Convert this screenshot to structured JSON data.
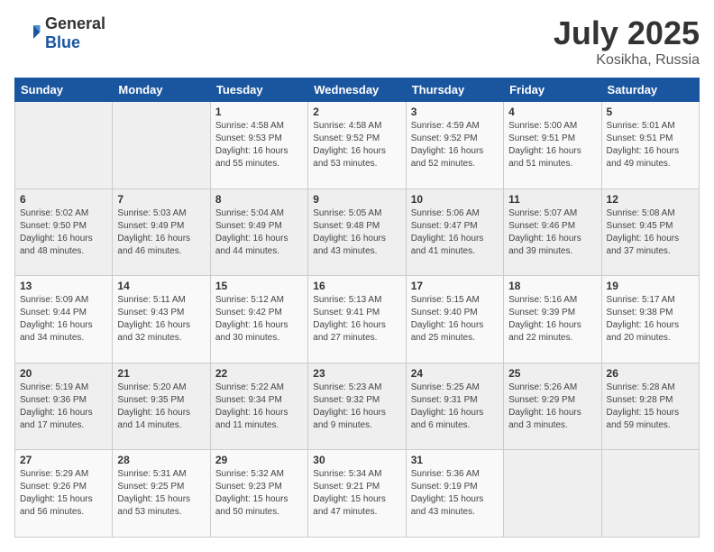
{
  "header": {
    "logo_general": "General",
    "logo_blue": "Blue",
    "month_year": "July 2025",
    "location": "Kosikha, Russia"
  },
  "weekdays": [
    "Sunday",
    "Monday",
    "Tuesday",
    "Wednesday",
    "Thursday",
    "Friday",
    "Saturday"
  ],
  "weeks": [
    [
      {
        "day": "",
        "details": ""
      },
      {
        "day": "",
        "details": ""
      },
      {
        "day": "1",
        "details": "Sunrise: 4:58 AM\nSunset: 9:53 PM\nDaylight: 16 hours\nand 55 minutes."
      },
      {
        "day": "2",
        "details": "Sunrise: 4:58 AM\nSunset: 9:52 PM\nDaylight: 16 hours\nand 53 minutes."
      },
      {
        "day": "3",
        "details": "Sunrise: 4:59 AM\nSunset: 9:52 PM\nDaylight: 16 hours\nand 52 minutes."
      },
      {
        "day": "4",
        "details": "Sunrise: 5:00 AM\nSunset: 9:51 PM\nDaylight: 16 hours\nand 51 minutes."
      },
      {
        "day": "5",
        "details": "Sunrise: 5:01 AM\nSunset: 9:51 PM\nDaylight: 16 hours\nand 49 minutes."
      }
    ],
    [
      {
        "day": "6",
        "details": "Sunrise: 5:02 AM\nSunset: 9:50 PM\nDaylight: 16 hours\nand 48 minutes."
      },
      {
        "day": "7",
        "details": "Sunrise: 5:03 AM\nSunset: 9:49 PM\nDaylight: 16 hours\nand 46 minutes."
      },
      {
        "day": "8",
        "details": "Sunrise: 5:04 AM\nSunset: 9:49 PM\nDaylight: 16 hours\nand 44 minutes."
      },
      {
        "day": "9",
        "details": "Sunrise: 5:05 AM\nSunset: 9:48 PM\nDaylight: 16 hours\nand 43 minutes."
      },
      {
        "day": "10",
        "details": "Sunrise: 5:06 AM\nSunset: 9:47 PM\nDaylight: 16 hours\nand 41 minutes."
      },
      {
        "day": "11",
        "details": "Sunrise: 5:07 AM\nSunset: 9:46 PM\nDaylight: 16 hours\nand 39 minutes."
      },
      {
        "day": "12",
        "details": "Sunrise: 5:08 AM\nSunset: 9:45 PM\nDaylight: 16 hours\nand 37 minutes."
      }
    ],
    [
      {
        "day": "13",
        "details": "Sunrise: 5:09 AM\nSunset: 9:44 PM\nDaylight: 16 hours\nand 34 minutes."
      },
      {
        "day": "14",
        "details": "Sunrise: 5:11 AM\nSunset: 9:43 PM\nDaylight: 16 hours\nand 32 minutes."
      },
      {
        "day": "15",
        "details": "Sunrise: 5:12 AM\nSunset: 9:42 PM\nDaylight: 16 hours\nand 30 minutes."
      },
      {
        "day": "16",
        "details": "Sunrise: 5:13 AM\nSunset: 9:41 PM\nDaylight: 16 hours\nand 27 minutes."
      },
      {
        "day": "17",
        "details": "Sunrise: 5:15 AM\nSunset: 9:40 PM\nDaylight: 16 hours\nand 25 minutes."
      },
      {
        "day": "18",
        "details": "Sunrise: 5:16 AM\nSunset: 9:39 PM\nDaylight: 16 hours\nand 22 minutes."
      },
      {
        "day": "19",
        "details": "Sunrise: 5:17 AM\nSunset: 9:38 PM\nDaylight: 16 hours\nand 20 minutes."
      }
    ],
    [
      {
        "day": "20",
        "details": "Sunrise: 5:19 AM\nSunset: 9:36 PM\nDaylight: 16 hours\nand 17 minutes."
      },
      {
        "day": "21",
        "details": "Sunrise: 5:20 AM\nSunset: 9:35 PM\nDaylight: 16 hours\nand 14 minutes."
      },
      {
        "day": "22",
        "details": "Sunrise: 5:22 AM\nSunset: 9:34 PM\nDaylight: 16 hours\nand 11 minutes."
      },
      {
        "day": "23",
        "details": "Sunrise: 5:23 AM\nSunset: 9:32 PM\nDaylight: 16 hours\nand 9 minutes."
      },
      {
        "day": "24",
        "details": "Sunrise: 5:25 AM\nSunset: 9:31 PM\nDaylight: 16 hours\nand 6 minutes."
      },
      {
        "day": "25",
        "details": "Sunrise: 5:26 AM\nSunset: 9:29 PM\nDaylight: 16 hours\nand 3 minutes."
      },
      {
        "day": "26",
        "details": "Sunrise: 5:28 AM\nSunset: 9:28 PM\nDaylight: 15 hours\nand 59 minutes."
      }
    ],
    [
      {
        "day": "27",
        "details": "Sunrise: 5:29 AM\nSunset: 9:26 PM\nDaylight: 15 hours\nand 56 minutes."
      },
      {
        "day": "28",
        "details": "Sunrise: 5:31 AM\nSunset: 9:25 PM\nDaylight: 15 hours\nand 53 minutes."
      },
      {
        "day": "29",
        "details": "Sunrise: 5:32 AM\nSunset: 9:23 PM\nDaylight: 15 hours\nand 50 minutes."
      },
      {
        "day": "30",
        "details": "Sunrise: 5:34 AM\nSunset: 9:21 PM\nDaylight: 15 hours\nand 47 minutes."
      },
      {
        "day": "31",
        "details": "Sunrise: 5:36 AM\nSunset: 9:19 PM\nDaylight: 15 hours\nand 43 minutes."
      },
      {
        "day": "",
        "details": ""
      },
      {
        "day": "",
        "details": ""
      }
    ]
  ]
}
